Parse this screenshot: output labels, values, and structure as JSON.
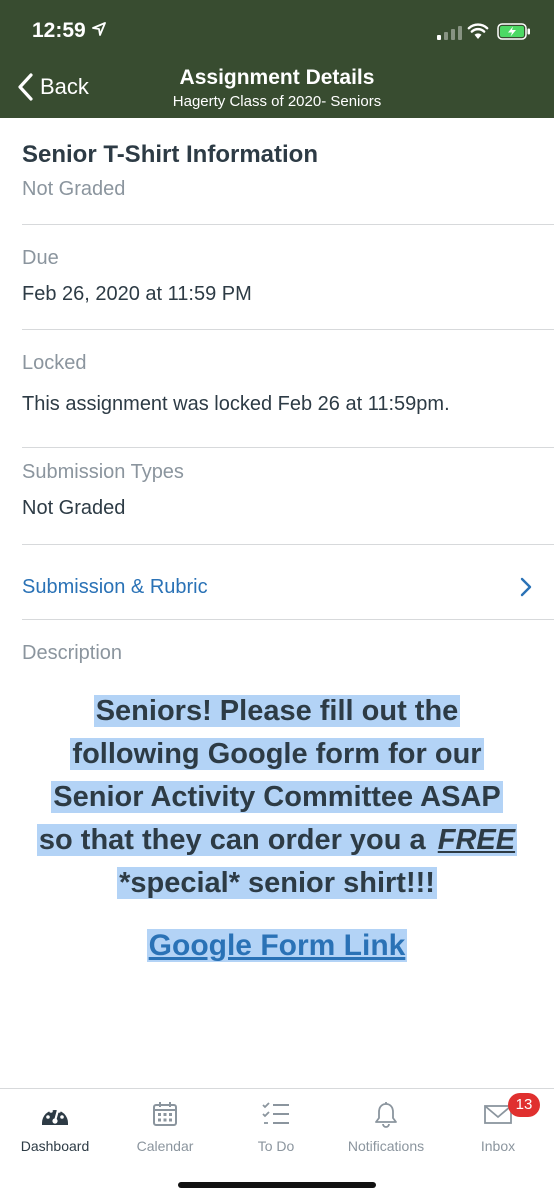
{
  "status_bar": {
    "time": "12:59"
  },
  "nav": {
    "back_label": "Back",
    "title": "Assignment Details",
    "subtitle": "Hagerty Class of 2020- Seniors"
  },
  "assignment": {
    "name": "Senior T-Shirt Information",
    "grading": "Not Graded",
    "due_label": "Due",
    "due_value": "Feb 26, 2020 at 11:59 PM",
    "locked_label": "Locked",
    "locked_value": "This assignment was locked Feb 26 at 11:59pm.",
    "submission_types_label": "Submission Types",
    "submission_types_value": "Not Graded",
    "rubric_link": "Submission & Rubric",
    "description_label": "Description"
  },
  "description": {
    "lines": [
      "Seniors! Please fill out the",
      "following Google form for our",
      "Senior Activity Committee ASAP",
      "so that they can order you a ",
      "FREE",
      "*special* senior shirt!!!"
    ],
    "link_text": "Google Form Link"
  },
  "tabbar": {
    "items": [
      {
        "label": "Dashboard",
        "icon": "dashboard-icon"
      },
      {
        "label": "Calendar",
        "icon": "calendar-icon"
      },
      {
        "label": "To Do",
        "icon": "todo-icon"
      },
      {
        "label": "Notifications",
        "icon": "bell-icon"
      },
      {
        "label": "Inbox",
        "icon": "mail-icon"
      }
    ],
    "active": "Dashboard",
    "inbox_badge": "13"
  },
  "colors": {
    "header_bg": "#384c30",
    "link": "#2a72b6",
    "highlight": "#b3d3f6",
    "badge": "#e0302f"
  }
}
